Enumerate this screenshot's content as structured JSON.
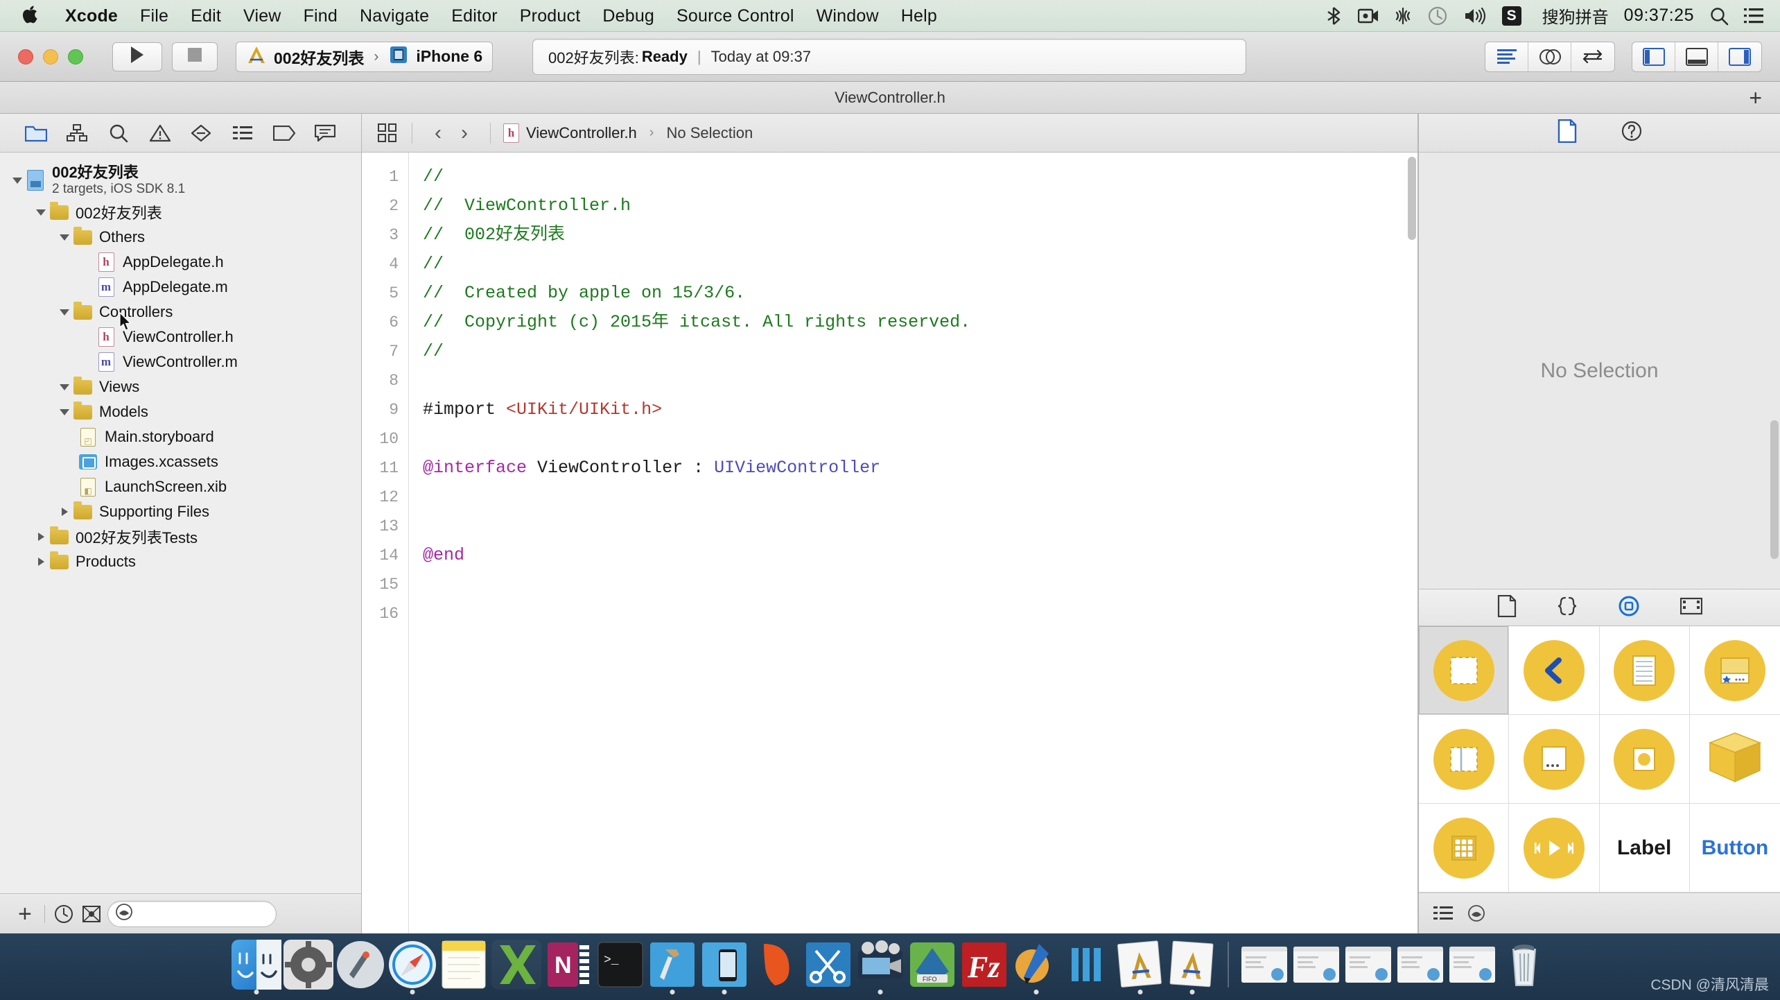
{
  "menubar": {
    "apple_icon": "apple-logo-icon",
    "items": [
      {
        "label": "Xcode",
        "bold": true
      },
      {
        "label": "File",
        "bold": false
      },
      {
        "label": "Edit",
        "bold": false
      },
      {
        "label": "View",
        "bold": false
      },
      {
        "label": "Find",
        "bold": false
      },
      {
        "label": "Navigate",
        "bold": false
      },
      {
        "label": "Editor",
        "bold": false
      },
      {
        "label": "Product",
        "bold": false
      },
      {
        "label": "Debug",
        "bold": false
      },
      {
        "label": "Source Control",
        "bold": false
      },
      {
        "label": "Window",
        "bold": false
      },
      {
        "label": "Help",
        "bold": false
      }
    ],
    "status": {
      "ime_badge": "S",
      "ime_name": "搜狗拼音",
      "clock": "09:37:25",
      "icons": [
        "bluetooth-icon",
        "screen-record-icon",
        "airplay-icon",
        "time-machine-icon",
        "volume-icon",
        "search-icon",
        "notification-center-icon"
      ]
    }
  },
  "toolbar": {
    "run_icon": "play-icon",
    "stop_icon": "stop-icon",
    "scheme_project": "002好友列表",
    "scheme_sep": "›",
    "scheme_device": "iPhone 6",
    "activity": {
      "project": "002好友列表:",
      "state": "Ready",
      "divider": "|",
      "time": "Today at 09:37"
    },
    "editor_segments": [
      "standard-editor-icon",
      "assistant-editor-icon",
      "version-editor-icon"
    ],
    "view_segments": [
      "toggle-navigator-icon",
      "toggle-debug-area-icon",
      "toggle-utilities-icon"
    ]
  },
  "titlestrip": {
    "title": "ViewController.h",
    "add_tab": "+"
  },
  "navigator": {
    "tabs": [
      "project-navigator-icon",
      "symbol-navigator-icon",
      "find-navigator-icon",
      "issue-navigator-icon",
      "test-navigator-icon",
      "debug-navigator-icon",
      "breakpoint-navigator-icon",
      "report-navigator-icon"
    ],
    "tree": [
      {
        "depth": 0,
        "disclosure": "open",
        "icon": "project-icon",
        "label": "002好友列表",
        "bold": true,
        "sub": "2 targets, iOS SDK 8.1"
      },
      {
        "depth": 1,
        "disclosure": "open",
        "icon": "folder-icon",
        "label": "002好友列表",
        "bold": false
      },
      {
        "depth": 2,
        "disclosure": "open",
        "icon": "folder-icon",
        "label": "Others",
        "bold": false
      },
      {
        "depth": 3,
        "disclosure": "none",
        "icon": "header-file-icon",
        "label": "AppDelegate.h",
        "bold": false
      },
      {
        "depth": 3,
        "disclosure": "none",
        "icon": "objc-file-icon",
        "label": "AppDelegate.m",
        "bold": false
      },
      {
        "depth": 2,
        "disclosure": "open",
        "icon": "folder-icon",
        "label": "Controllers",
        "bold": false
      },
      {
        "depth": 3,
        "disclosure": "none",
        "icon": "header-file-icon",
        "label": "ViewController.h",
        "bold": false
      },
      {
        "depth": 3,
        "disclosure": "none",
        "icon": "objc-file-icon",
        "label": "ViewController.m",
        "bold": false
      },
      {
        "depth": 2,
        "disclosure": "open",
        "icon": "folder-icon",
        "label": "Views",
        "bold": false
      },
      {
        "depth": 2,
        "disclosure": "open",
        "icon": "folder-icon",
        "label": "Models",
        "bold": false
      },
      {
        "depth": 3,
        "disclosure": "none",
        "icon": "storyboard-icon",
        "label": "Main.storyboard",
        "bold": false
      },
      {
        "depth": 3,
        "disclosure": "none",
        "icon": "xcassets-icon",
        "label": "Images.xcassets",
        "bold": false
      },
      {
        "depth": 3,
        "disclosure": "none",
        "icon": "xib-icon",
        "label": "LaunchScreen.xib",
        "bold": false
      },
      {
        "depth": 2,
        "disclosure": "closed",
        "icon": "folder-icon",
        "label": "Supporting Files",
        "bold": false
      },
      {
        "depth": 1,
        "disclosure": "closed",
        "icon": "folder-icon",
        "label": "002好友列表Tests",
        "bold": false
      },
      {
        "depth": 1,
        "disclosure": "closed",
        "icon": "folder-icon",
        "label": "Products",
        "bold": false
      }
    ],
    "filter_bar": {
      "add": "+",
      "icons": [
        "recent-files-icon",
        "source-control-filter-icon",
        "filter-search-icon"
      ],
      "placeholder": ""
    }
  },
  "editor": {
    "jumpbar": {
      "grid_icon": "related-items-icon",
      "back_icon": "‹",
      "forward_icon": "›",
      "file_icon": "header-file-icon",
      "file_name": "ViewController.h",
      "chevron": "›",
      "selection": "No Selection"
    },
    "line_numbers": [
      1,
      2,
      3,
      4,
      5,
      6,
      7,
      8,
      9,
      10,
      11,
      12,
      13,
      14,
      15,
      16
    ],
    "lines": [
      {
        "n": 1,
        "tokens": [
          {
            "t": "//",
            "c": "comment"
          }
        ]
      },
      {
        "n": 2,
        "tokens": [
          {
            "t": "//  ViewController.h",
            "c": "comment"
          }
        ]
      },
      {
        "n": 3,
        "tokens": [
          {
            "t": "//  002好友列表",
            "c": "comment"
          }
        ]
      },
      {
        "n": 4,
        "tokens": [
          {
            "t": "//",
            "c": "comment"
          }
        ]
      },
      {
        "n": 5,
        "tokens": [
          {
            "t": "//  Created by apple on 15/3/6.",
            "c": "comment"
          }
        ]
      },
      {
        "n": 6,
        "tokens": [
          {
            "t": "//  Copyright (c) 2015年 itcast. All rights reserved.",
            "c": "comment"
          }
        ]
      },
      {
        "n": 7,
        "tokens": [
          {
            "t": "//",
            "c": "comment"
          }
        ]
      },
      {
        "n": 8,
        "tokens": []
      },
      {
        "n": 9,
        "tokens": [
          {
            "t": "#import ",
            "c": "pre"
          },
          {
            "t": "<UIKit/UIKit.h>",
            "c": "str"
          }
        ]
      },
      {
        "n": 10,
        "tokens": []
      },
      {
        "n": 11,
        "tokens": [
          {
            "t": "@interface",
            "c": "kw"
          },
          {
            "t": " ViewController ",
            "c": "plain"
          },
          {
            "t": ": ",
            "c": "plain"
          },
          {
            "t": "UIViewController",
            "c": "type"
          }
        ]
      },
      {
        "n": 12,
        "tokens": []
      },
      {
        "n": 13,
        "tokens": []
      },
      {
        "n": 14,
        "tokens": [
          {
            "t": "@end",
            "c": "kw"
          }
        ]
      },
      {
        "n": 15,
        "tokens": []
      },
      {
        "n": 16,
        "tokens": []
      }
    ]
  },
  "inspector": {
    "tabs": [
      "file-inspector-icon",
      "quick-help-inspector-icon"
    ],
    "no_selection": "No Selection",
    "library_tabs": [
      "file-template-library-icon",
      "code-snippet-library-icon",
      "object-library-icon",
      "media-library-icon"
    ],
    "library_items": [
      {
        "name": "view-object",
        "kind": "icon",
        "glyph": "view",
        "selected": true
      },
      {
        "name": "back-chevron-object",
        "kind": "icon",
        "glyph": "chevron",
        "selected": false
      },
      {
        "name": "scroll-view-object",
        "kind": "icon",
        "glyph": "lines",
        "selected": false
      },
      {
        "name": "table-view-cell-object",
        "kind": "icon",
        "glyph": "cell",
        "selected": false
      },
      {
        "name": "split-view-object",
        "kind": "icon",
        "glyph": "split",
        "selected": false
      },
      {
        "name": "toolbar-object",
        "kind": "icon",
        "glyph": "dots",
        "selected": false
      },
      {
        "name": "image-view-object",
        "kind": "icon",
        "glyph": "circle",
        "selected": false
      },
      {
        "name": "cube-object",
        "kind": "icon",
        "glyph": "cube",
        "selected": false
      },
      {
        "name": "collection-view-object",
        "kind": "icon",
        "glyph": "grid",
        "selected": false
      },
      {
        "name": "player-object",
        "kind": "icon",
        "glyph": "player",
        "selected": false
      },
      {
        "name": "label-object",
        "kind": "text",
        "glyph": "Label",
        "selected": false
      },
      {
        "name": "button-object",
        "kind": "text",
        "glyph": "Button",
        "selected": false
      }
    ],
    "footer_icons": [
      "list-view-icon",
      "filter-search-icon"
    ]
  },
  "dock": {
    "items": [
      {
        "name": "finder",
        "running": true
      },
      {
        "name": "system-preferences",
        "running": false
      },
      {
        "name": "launchpad",
        "running": false
      },
      {
        "name": "safari",
        "running": true
      },
      {
        "name": "notes",
        "running": false
      },
      {
        "name": "excel",
        "running": false
      },
      {
        "name": "onenote",
        "running": false
      },
      {
        "name": "terminal",
        "running": false
      },
      {
        "name": "utility-hammer",
        "running": true
      },
      {
        "name": "mobile-device",
        "running": true
      },
      {
        "name": "pixelmator",
        "running": false
      },
      {
        "name": "snip-tool",
        "running": false
      },
      {
        "name": "imovie",
        "running": true
      },
      {
        "name": "feedly",
        "running": false
      },
      {
        "name": "filezilla",
        "running": false
      },
      {
        "name": "ppt-app",
        "running": true
      },
      {
        "name": "mweb",
        "running": false
      },
      {
        "name": "xcode-a",
        "running": true
      },
      {
        "name": "xcode-b",
        "running": true
      }
    ],
    "minimized": [
      {
        "name": "minimized-window-1"
      },
      {
        "name": "minimized-window-2"
      },
      {
        "name": "minimized-window-3"
      },
      {
        "name": "minimized-window-4"
      },
      {
        "name": "minimized-window-5"
      }
    ],
    "trash": "trash-icon"
  },
  "watermark": "CSDN @清风清晨"
}
